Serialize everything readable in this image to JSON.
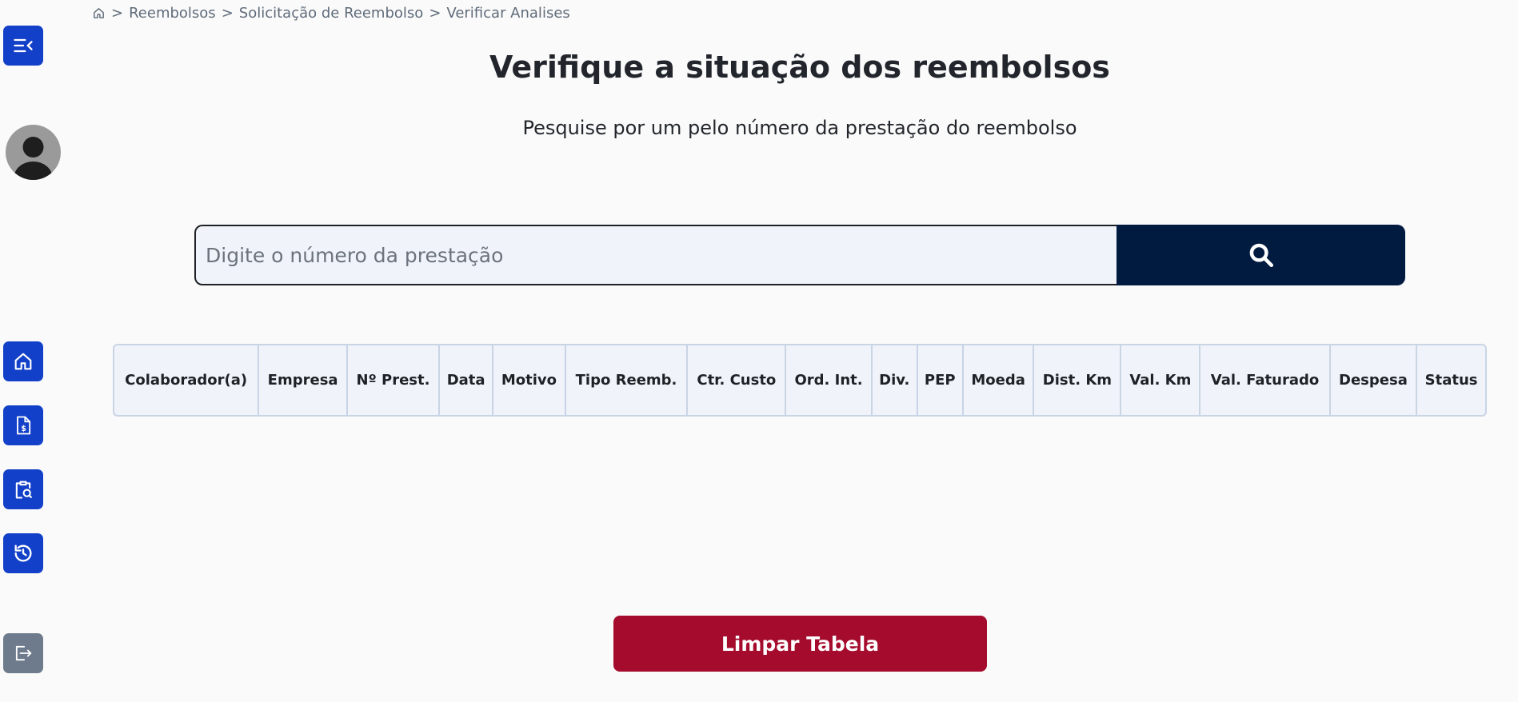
{
  "breadcrumb": {
    "items": [
      "Reembolsos",
      "Solicitação de Reembolso",
      "Verificar Analises"
    ],
    "separator": ">"
  },
  "header": {
    "title": "Verifique a situação dos reembolsos",
    "subtitle": "Pesquise por um pelo número da prestação do reembolso"
  },
  "search": {
    "placeholder": "Digite o número da prestação",
    "value": "",
    "button_icon": "search-icon"
  },
  "table": {
    "columns": [
      "Colaborador(a)",
      "Empresa",
      "Nº Prest.",
      "Data",
      "Motivo",
      "Tipo Reemb.",
      "Ctr. Custo",
      "Ord. Int.",
      "Div.",
      "PEP",
      "Moeda",
      "Dist. Km",
      "Val. Km",
      "Val. Faturado",
      "Despesa",
      "Status"
    ],
    "rows": []
  },
  "actions": {
    "clear_label": "Limpar Tabela"
  },
  "sidebar": {
    "items": [
      {
        "icon": "menu-collapse-icon"
      },
      {
        "icon": "home-icon"
      },
      {
        "icon": "document-dollar-icon"
      },
      {
        "icon": "clipboard-search-icon"
      },
      {
        "icon": "history-icon"
      },
      {
        "icon": "logout-icon"
      }
    ]
  },
  "colors": {
    "sidebar_button": "#1240c8",
    "logout_button": "#6e7b8c",
    "search_button": "#001a40",
    "clear_button": "#a50b2d",
    "table_header_bg": "#f0f4fa"
  }
}
